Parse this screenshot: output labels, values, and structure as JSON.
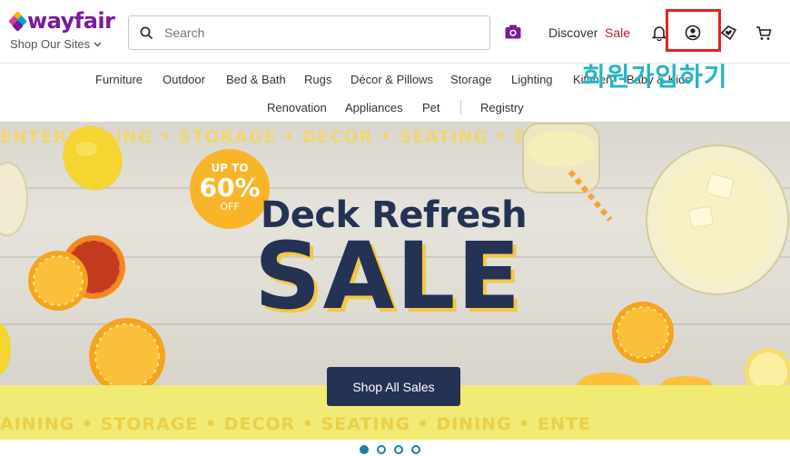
{
  "header": {
    "brand": "wayfair",
    "shop_sites": "Shop Our Sites",
    "search_placeholder": "Search",
    "discover": "Discover",
    "sale": "Sale"
  },
  "annotation": {
    "label": "회원가입하기",
    "color": "#24b3c4",
    "box_color": "#e8201f"
  },
  "categories": {
    "row1": [
      "Furniture",
      "Outdoor",
      "Bed & Bath",
      "Rugs",
      "Décor & Pillows",
      "Storage",
      "Lighting",
      "Kitchen",
      "Baby & Kids"
    ],
    "row2": [
      "Renovation",
      "Appliances",
      "Pet",
      "Registry"
    ]
  },
  "hero": {
    "badge_top": "UP TO",
    "badge_value": "60%",
    "badge_bottom": "OFF",
    "headline": "Deck Refresh",
    "sale_word": "SALE",
    "cta": "Shop All Sales",
    "ticker_top": "ENTERTAINING  •  STORAGE  •  DECOR  •  SEATING  •  DINING",
    "ticker_bottom": "AINING  •  STORAGE  •  DECOR  •  SEATING  •  DINING  •  ENTE"
  },
  "colors": {
    "brand_purple": "#7b189f",
    "navy": "#243253",
    "sale_red": "#b3203f",
    "badge_yellow": "#f9b528",
    "dot_teal": "#1e7fa0"
  },
  "carousel": {
    "total_slides": 4,
    "active_slide": 1
  },
  "icons": [
    "search-icon",
    "camera-icon",
    "bell-icon",
    "account-icon",
    "lists-icon",
    "cart-icon"
  ]
}
